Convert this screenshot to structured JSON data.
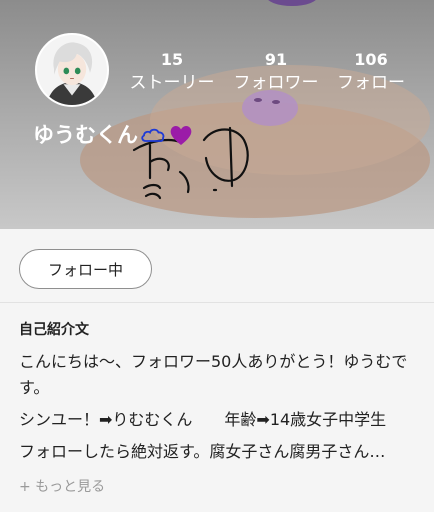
{
  "profile": {
    "username": "ゆうむくん",
    "stats": [
      {
        "count": "15",
        "label": "ストーリー"
      },
      {
        "count": "91",
        "label": "フォロワー"
      },
      {
        "count": "106",
        "label": "フォロー"
      }
    ],
    "follow_button": "フォロー中",
    "bio_heading": "自己紹介文",
    "bio_lines": [
      "こんにちは〜、フォロワー50人ありがとう！ゆうむです。",
      "シンユー！➡りむむくん　　年齢➡14歳女子中学生",
      "フォローしたら絶対返す。腐女子さん腐男子さん…"
    ],
    "more_link": "+ もっと見る"
  },
  "colors": {
    "cloud_icon": "#1f3bd6",
    "heart_icon": "#9b1ca8",
    "follow_button_border": "#8f8f8f",
    "text_primary": "#222222",
    "text_muted": "#9a9a9a"
  }
}
